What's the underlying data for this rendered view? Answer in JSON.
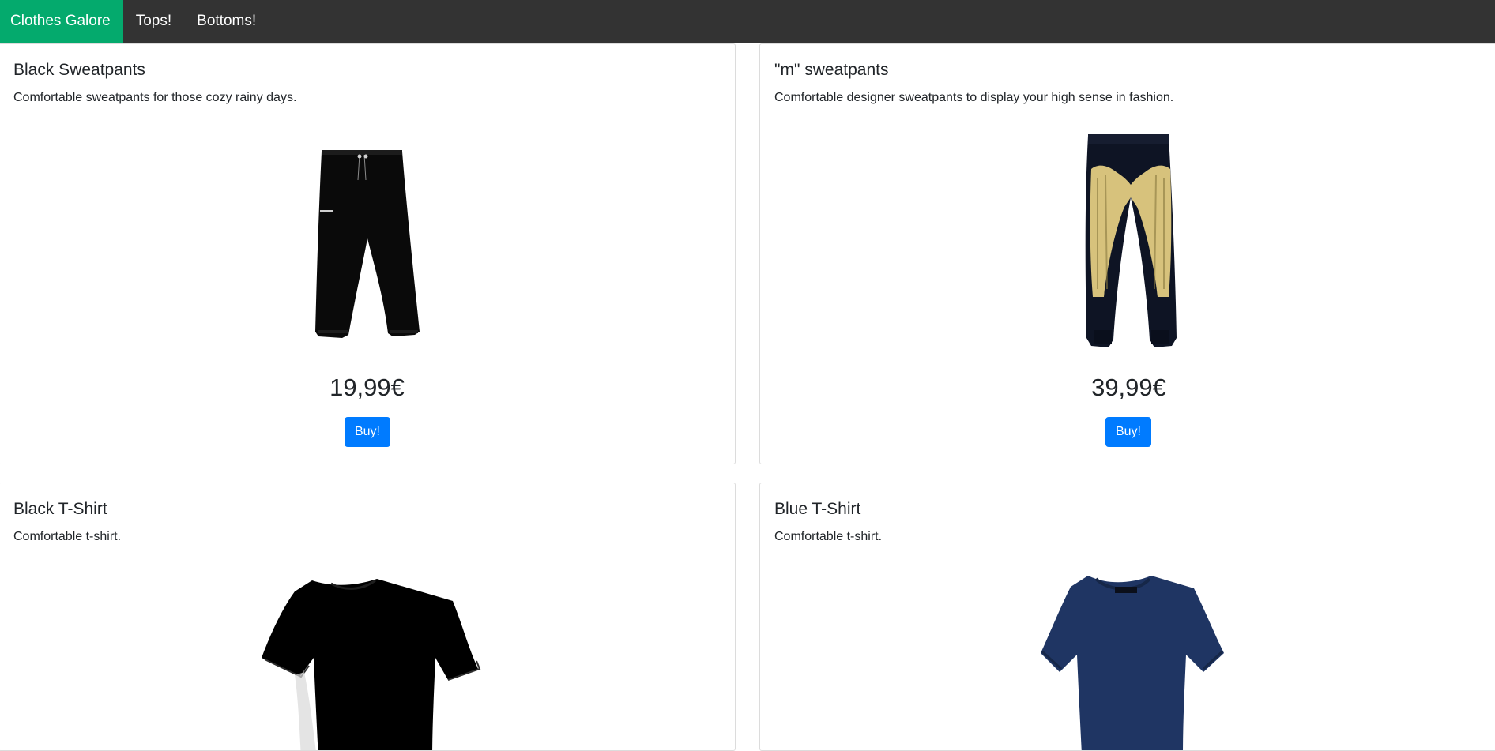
{
  "nav": {
    "brand": "Clothes Galore",
    "links": [
      "Tops!",
      "Bottoms!"
    ]
  },
  "products": [
    {
      "title": "Black Sweatpants",
      "description": "Comfortable sweatpants for those cozy rainy days.",
      "price": "19,99€",
      "buy_label": "Buy!",
      "image_icon": "black-sweatpants-image"
    },
    {
      "title": "\"m\" sweatpants",
      "description": "Comfortable designer sweatpants to display your high sense in fashion.",
      "price": "39,99€",
      "buy_label": "Buy!",
      "image_icon": "printed-sweatpants-image"
    },
    {
      "title": "Black T-Shirt",
      "description": "Comfortable t-shirt.",
      "image_icon": "black-tshirt-image"
    },
    {
      "title": "Blue T-Shirt",
      "description": "Comfortable t-shirt.",
      "image_icon": "blue-tshirt-image"
    }
  ],
  "colors": {
    "nav_background": "#333333",
    "brand_active": "#04aa6d",
    "button_primary": "#007bff"
  }
}
